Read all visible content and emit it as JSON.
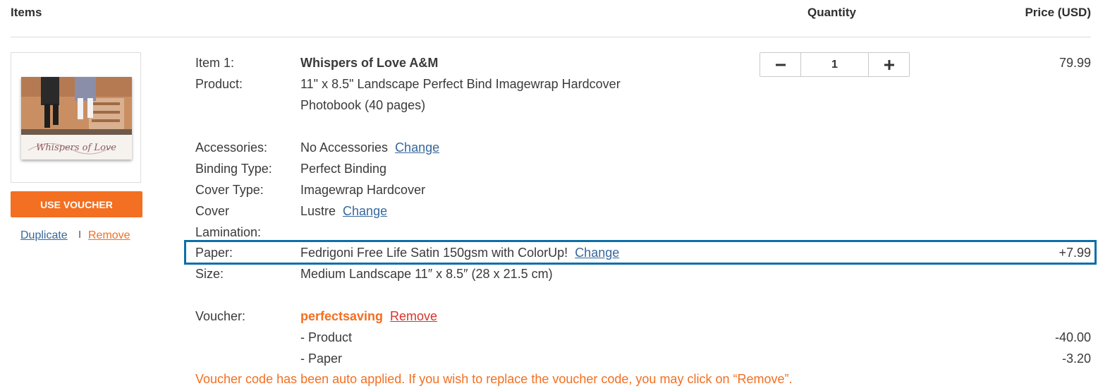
{
  "header": {
    "items": "Items",
    "quantity": "Quantity",
    "price": "Price (USD)"
  },
  "sidebar": {
    "voucher_button": "USE VOUCHER",
    "duplicate": "Duplicate",
    "separator": "I",
    "remove": "Remove",
    "thumbnail_title": "Whispers of Love"
  },
  "item": {
    "item_label": "Item 1:",
    "item_name": "Whispers of Love A&M",
    "product_label": "Product:",
    "product_line1": "11\" x 8.5\" Landscape Perfect Bind Imagewrap Hardcover",
    "product_line2": "Photobook (40 pages)",
    "accessories_label": "Accessories:",
    "accessories_value": "No Accessories",
    "accessories_change": "Change",
    "binding_label": "Binding Type:",
    "binding_value": "Perfect Binding",
    "cover_type_label": "Cover Type:",
    "cover_type_value": "Imagewrap Hardcover",
    "cover_lam_label_1": "Cover",
    "cover_lam_label_2": "Lamination:",
    "cover_lam_value": "Lustre",
    "cover_lam_change": "Change",
    "paper_label": "Paper:",
    "paper_value": "Fedrigoni Free Life Satin 150gsm with ColorUp!",
    "paper_change": "Change",
    "paper_price": "+7.99",
    "size_label": "Size:",
    "size_value": "Medium Landscape 11″ x 8.5″ (28 x 21.5 cm)",
    "voucher_label": "Voucher:",
    "voucher_code": "perfectsaving",
    "voucher_remove": "Remove",
    "discount_product_label": "- Product",
    "discount_product_value": "-40.00",
    "discount_paper_label": "- Paper",
    "discount_paper_value": "-3.20",
    "price": "79.99",
    "quantity": "1",
    "note": "Voucher code has been auto applied. If you wish to replace the voucher code, you may click on “Remove”."
  },
  "colors": {
    "accent": "#f36f21",
    "link": "#36679c",
    "highlight": "#0c6fa8",
    "remove_red": "#d9342b"
  },
  "icons": {
    "minus": "minus-icon",
    "plus": "plus-icon"
  }
}
